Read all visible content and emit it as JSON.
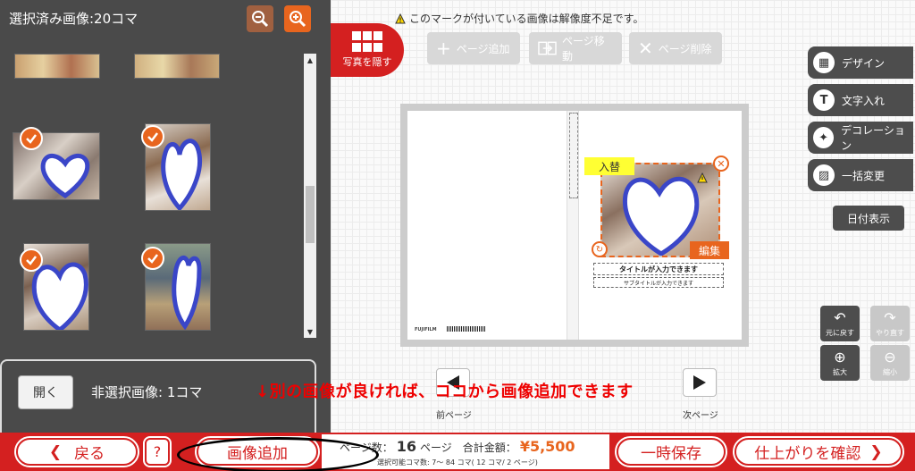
{
  "left_panel": {
    "title": "選択済み画像:20コマ",
    "nonselected_label": "非選択画像: 1コマ",
    "open_label": "開く"
  },
  "toolbar": {
    "notice": "このマークが付いている画像は解像度不足です。",
    "hide_photos": "写真を隠す",
    "add_page": "ページ追加",
    "move_page": "ページ移動",
    "delete_page": "ページ削除"
  },
  "page_editor": {
    "replace": "入替",
    "edit": "編集",
    "title_placeholder": "タイトルが入力できます",
    "subtitle_placeholder": "サブタイトルが入力できます",
    "brand": "FUJIFILM"
  },
  "right_tools": {
    "design": "デザイン",
    "text": "文字入れ",
    "decoration": "デコレーション",
    "bulk_change": "一括変更",
    "date_display": "日付表示",
    "undo": "元に戻す",
    "redo": "やり直す",
    "zoom_in": "拡大",
    "zoom_out": "縮小"
  },
  "nav": {
    "prev": "前ページ",
    "next": "次ページ"
  },
  "annotation": "↓別の画像が良ければ、ココから画像追加できます",
  "bottom": {
    "back": "戻る",
    "help": "?",
    "add_image": "画像追加",
    "pages_label": "ページ数：",
    "pages_value": "16",
    "pages_unit": "ページ",
    "total_label": "合計金額：",
    "total_value": "¥5,500",
    "selectable_info": "選択可能コマ数: 7～ 84 コマ( 12 コマ/ 2 ページ)",
    "save": "一時保存",
    "confirm": "仕上がりを確認"
  },
  "colors": {
    "accent_red": "#d42020",
    "accent_orange": "#e8651e",
    "heart_stroke": "#3a46c8"
  }
}
